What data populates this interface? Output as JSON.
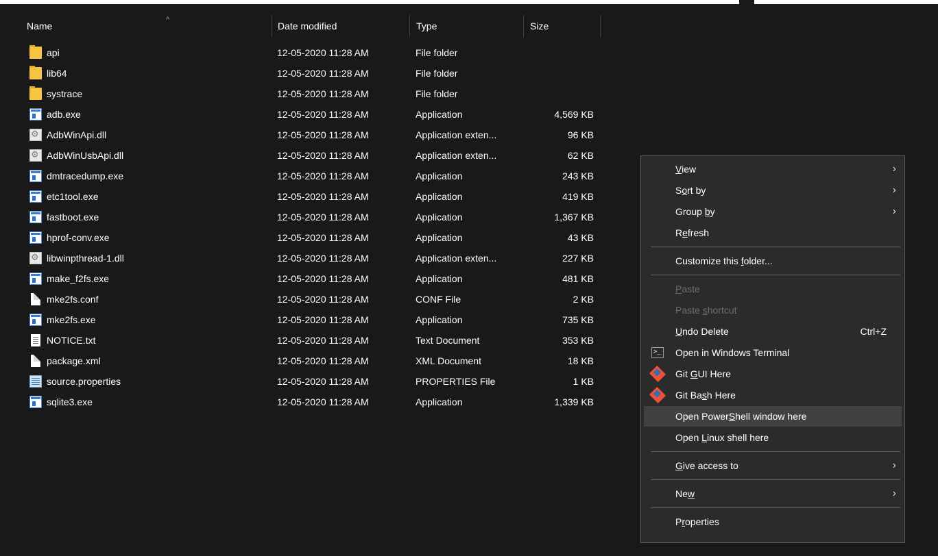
{
  "header": {
    "name": "Name",
    "date": "Date modified",
    "type": "Type",
    "size": "Size",
    "sort_arrow": "^"
  },
  "files": [
    {
      "name": "api",
      "date": "12-05-2020 11:28 AM",
      "type": "File folder",
      "size": "",
      "icon": "folder-icon"
    },
    {
      "name": "lib64",
      "date": "12-05-2020 11:28 AM",
      "type": "File folder",
      "size": "",
      "icon": "folder-icon"
    },
    {
      "name": "systrace",
      "date": "12-05-2020 11:28 AM",
      "type": "File folder",
      "size": "",
      "icon": "folder-icon"
    },
    {
      "name": "adb.exe",
      "date": "12-05-2020 11:28 AM",
      "type": "Application",
      "size": "4,569 KB",
      "icon": "application-icon"
    },
    {
      "name": "AdbWinApi.dll",
      "date": "12-05-2020 11:28 AM",
      "type": "Application exten...",
      "size": "96 KB",
      "icon": "dll-icon"
    },
    {
      "name": "AdbWinUsbApi.dll",
      "date": "12-05-2020 11:28 AM",
      "type": "Application exten...",
      "size": "62 KB",
      "icon": "dll-icon"
    },
    {
      "name": "dmtracedump.exe",
      "date": "12-05-2020 11:28 AM",
      "type": "Application",
      "size": "243 KB",
      "icon": "application-icon"
    },
    {
      "name": "etc1tool.exe",
      "date": "12-05-2020 11:28 AM",
      "type": "Application",
      "size": "419 KB",
      "icon": "application-icon"
    },
    {
      "name": "fastboot.exe",
      "date": "12-05-2020 11:28 AM",
      "type": "Application",
      "size": "1,367 KB",
      "icon": "application-icon"
    },
    {
      "name": "hprof-conv.exe",
      "date": "12-05-2020 11:28 AM",
      "type": "Application",
      "size": "43 KB",
      "icon": "application-icon"
    },
    {
      "name": "libwinpthread-1.dll",
      "date": "12-05-2020 11:28 AM",
      "type": "Application exten...",
      "size": "227 KB",
      "icon": "dll-icon"
    },
    {
      "name": "make_f2fs.exe",
      "date": "12-05-2020 11:28 AM",
      "type": "Application",
      "size": "481 KB",
      "icon": "application-icon"
    },
    {
      "name": "mke2fs.conf",
      "date": "12-05-2020 11:28 AM",
      "type": "CONF File",
      "size": "2 KB",
      "icon": "file-icon"
    },
    {
      "name": "mke2fs.exe",
      "date": "12-05-2020 11:28 AM",
      "type": "Application",
      "size": "735 KB",
      "icon": "application-icon"
    },
    {
      "name": "NOTICE.txt",
      "date": "12-05-2020 11:28 AM",
      "type": "Text Document",
      "size": "353 KB",
      "icon": "text-document-icon"
    },
    {
      "name": "package.xml",
      "date": "12-05-2020 11:28 AM",
      "type": "XML Document",
      "size": "18 KB",
      "icon": "file-icon"
    },
    {
      "name": "source.properties",
      "date": "12-05-2020 11:28 AM",
      "type": "PROPERTIES File",
      "size": "1 KB",
      "icon": "properties-icon"
    },
    {
      "name": "sqlite3.exe",
      "date": "12-05-2020 11:28 AM",
      "type": "Application",
      "size": "1,339 KB",
      "icon": "application-icon"
    }
  ],
  "context_menu": {
    "items": [
      {
        "pre": "",
        "key": "V",
        "post": "iew",
        "submenu": true,
        "name": "menu-item-view"
      },
      {
        "pre": "S",
        "key": "o",
        "post": "rt by",
        "submenu": true,
        "name": "menu-item-sort-by"
      },
      {
        "pre": "Group ",
        "key": "b",
        "post": "y",
        "submenu": true,
        "name": "menu-item-group-by"
      },
      {
        "pre": "R",
        "key": "e",
        "post": "fresh",
        "name": "menu-item-refresh"
      },
      {
        "sep": true
      },
      {
        "pre": "Customize this ",
        "key": "f",
        "post": "older...",
        "name": "menu-item-customize-folder"
      },
      {
        "sep": true
      },
      {
        "pre": "",
        "key": "P",
        "post": "aste",
        "disabled": true,
        "name": "menu-item-paste"
      },
      {
        "pre": "Paste ",
        "key": "s",
        "post": "hortcut",
        "disabled": true,
        "name": "menu-item-paste-shortcut"
      },
      {
        "pre": "",
        "key": "U",
        "post": "ndo Delete",
        "shortcut": "Ctrl+Z",
        "name": "menu-item-undo-delete"
      },
      {
        "pre": "Open in Windows Terminal",
        "key": "",
        "post": "",
        "icon": "terminal-icon",
        "name": "menu-item-open-terminal"
      },
      {
        "pre": "Git ",
        "key": "G",
        "post": "UI Here",
        "icon": "git-icon",
        "name": "menu-item-git-gui"
      },
      {
        "pre": "Git Ba",
        "key": "s",
        "post": "h Here",
        "icon": "git-icon",
        "name": "menu-item-git-bash"
      },
      {
        "pre": "Open Power",
        "key": "S",
        "post": "hell window here",
        "hover": true,
        "name": "menu-item-open-powershell"
      },
      {
        "pre": "Open ",
        "key": "L",
        "post": "inux shell here",
        "name": "menu-item-open-linux-shell"
      },
      {
        "sep": true
      },
      {
        "pre": "",
        "key": "G",
        "post": "ive access to",
        "submenu": true,
        "name": "menu-item-give-access"
      },
      {
        "sep": true
      },
      {
        "pre": "Ne",
        "key": "w",
        "post": "",
        "submenu": true,
        "name": "menu-item-new"
      },
      {
        "sep": true
      },
      {
        "pre": "P",
        "key": "r",
        "post": "operties",
        "name": "menu-item-properties"
      }
    ]
  }
}
